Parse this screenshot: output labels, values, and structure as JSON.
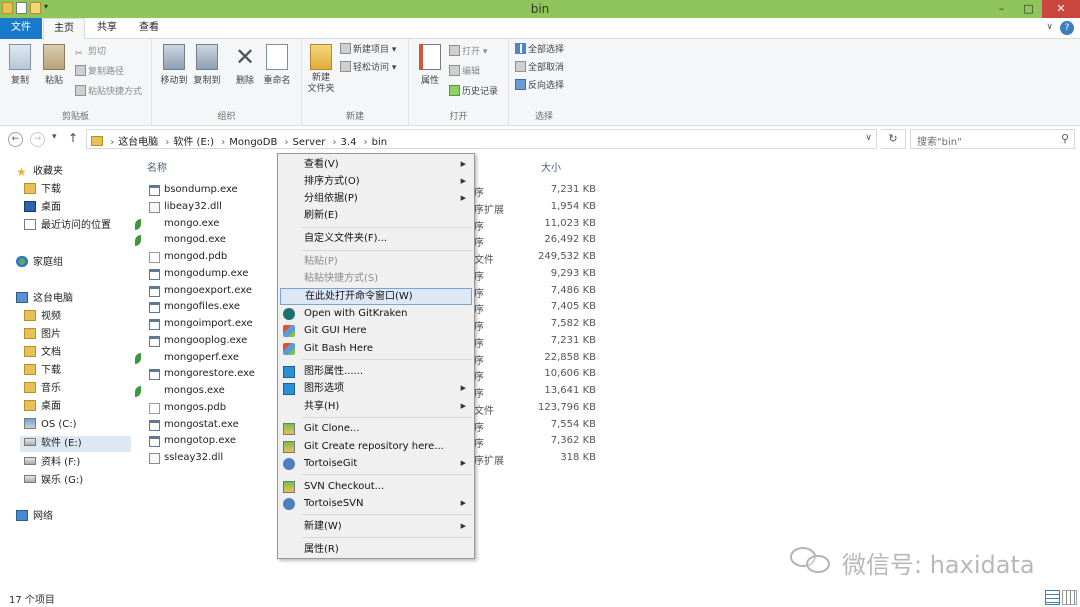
{
  "window": {
    "title": "bin",
    "minimize": "–",
    "maximize": "□",
    "close": "✕"
  },
  "tabs": {
    "file": "文件",
    "home": "主页",
    "share": "共享",
    "view": "查看",
    "help": "?",
    "collapse": "∨"
  },
  "ribbon": {
    "clipboard": {
      "label": "剪贴板",
      "copy": "复制",
      "paste": "粘贴",
      "cut": "剪切",
      "copy_path": "复制路径",
      "paste_shortcut": "粘贴快捷方式"
    },
    "organize": {
      "label": "组织",
      "move_to": "移动到",
      "copy_to": "复制到",
      "delete": "删除",
      "rename": "重命名"
    },
    "new": {
      "label": "新建",
      "new_folder": "新建\n文件夹",
      "new_item": "新建项目 ▾",
      "easy_access": "轻松访问 ▾"
    },
    "open": {
      "label": "打开",
      "properties": "属性",
      "open": "打开 ▾",
      "edit": "编辑",
      "history": "历史记录"
    },
    "select": {
      "label": "选择",
      "select_all": "全部选择",
      "select_none": "全部取消",
      "invert": "反向选择"
    }
  },
  "address": {
    "back": "←",
    "forward": "→",
    "recent": "▾",
    "up": "↑",
    "crumbs": [
      "这台电脑",
      "软件 (E:)",
      "MongoDB",
      "Server",
      "3.4",
      "bin"
    ],
    "dropdown": "∨",
    "refresh": "↻",
    "search_placeholder": "搜索\"bin\"",
    "search_icon": "⚲"
  },
  "nav": {
    "favorites": "收藏夹",
    "downloads": "下载",
    "desktop": "桌面",
    "recent": "最近访问的位置",
    "homegroup": "家庭组",
    "thispc": "这台电脑",
    "videos": "视频",
    "pictures": "图片",
    "documents": "文档",
    "downloads2": "下载",
    "music": "音乐",
    "desktop2": "桌面",
    "os": "OS (C:)",
    "soft": "软件 (E:)",
    "data": "资料 (F:)",
    "ent": "娱乐 (G:)",
    "network": "网络"
  },
  "columns": {
    "name": "名称",
    "size": "大小"
  },
  "files": [
    {
      "name": "bsondump.exe",
      "type": "序",
      "size": "7,231 KB",
      "icon": "exe"
    },
    {
      "name": "libeay32.dll",
      "type": "序扩展",
      "size": "1,954 KB",
      "icon": "dll"
    },
    {
      "name": "mongo.exe",
      "type": "序",
      "size": "11,023 KB",
      "icon": "leaf"
    },
    {
      "name": "mongod.exe",
      "type": "序",
      "size": "26,492 KB",
      "icon": "leaf"
    },
    {
      "name": "mongod.pdb",
      "type": "文件",
      "size": "249,532 KB",
      "icon": "pdb"
    },
    {
      "name": "mongodump.exe",
      "type": "序",
      "size": "9,293 KB",
      "icon": "exe"
    },
    {
      "name": "mongoexport.exe",
      "type": "序",
      "size": "7,486 KB",
      "icon": "exe"
    },
    {
      "name": "mongofiles.exe",
      "type": "序",
      "size": "7,405 KB",
      "icon": "exe"
    },
    {
      "name": "mongoimport.exe",
      "type": "序",
      "size": "7,582 KB",
      "icon": "exe"
    },
    {
      "name": "mongooplog.exe",
      "type": "序",
      "size": "7,231 KB",
      "icon": "exe"
    },
    {
      "name": "mongoperf.exe",
      "type": "序",
      "size": "22,858 KB",
      "icon": "leaf"
    },
    {
      "name": "mongorestore.exe",
      "type": "序",
      "size": "10,606 KB",
      "icon": "exe"
    },
    {
      "name": "mongos.exe",
      "type": "序",
      "size": "13,641 KB",
      "icon": "leaf"
    },
    {
      "name": "mongos.pdb",
      "type": "文件",
      "size": "123,796 KB",
      "icon": "pdb"
    },
    {
      "name": "mongostat.exe",
      "type": "序",
      "size": "7,554 KB",
      "icon": "exe"
    },
    {
      "name": "mongotop.exe",
      "type": "序",
      "size": "7,362 KB",
      "icon": "exe"
    },
    {
      "name": "ssleay32.dll",
      "type": "序扩展",
      "size": "318 KB",
      "icon": "dll"
    }
  ],
  "menu": {
    "view": "查看(V)",
    "sort": "排序方式(O)",
    "group": "分组依据(P)",
    "refresh": "刷新(E)",
    "customize": "自定义文件夹(F)...",
    "paste": "粘贴(P)",
    "paste_shortcut": "粘贴快捷方式(S)",
    "open_cmd": "在此处打开命令窗口(W)",
    "gitkraken": "Open with GitKraken",
    "git_gui": "Git GUI Here",
    "git_bash": "Git Bash Here",
    "graphics_props": "图形属性......",
    "graphics_opts": "图形选项",
    "share": "共享(H)",
    "git_clone": "Git Clone...",
    "git_create": "Git Create repository here...",
    "tortoisegit": "TortoiseGit",
    "svn_checkout": "SVN Checkout...",
    "tortoisesvn": "TortoiseSVN",
    "new": "新建(W)",
    "properties": "属性(R)",
    "arrow": "▶"
  },
  "status": {
    "count": "17 个项目"
  },
  "watermark": {
    "text": "微信号: haxidata"
  }
}
